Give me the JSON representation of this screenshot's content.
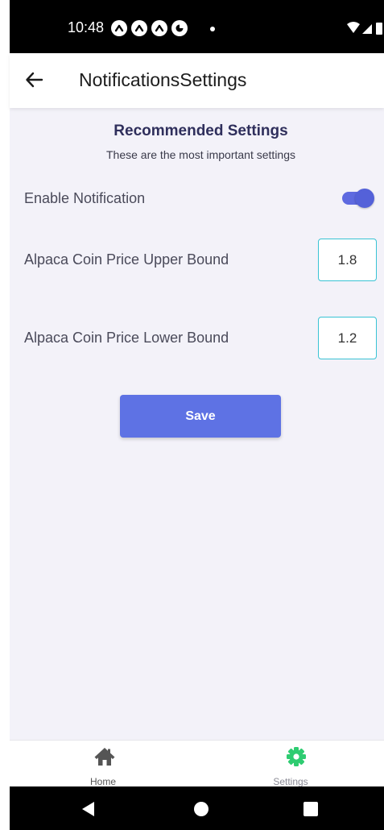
{
  "status_bar": {
    "time": "10:48"
  },
  "app_bar": {
    "title": "NotificationsSettings"
  },
  "section": {
    "title": "Recommended Settings",
    "subtitle": "These are the most important settings"
  },
  "settings": {
    "enable_notification": {
      "label": "Enable Notification",
      "enabled": true
    },
    "upper_bound": {
      "label": "Alpaca Coin Price Upper Bound",
      "value": "1.8"
    },
    "lower_bound": {
      "label": "Alpaca Coin Price Lower Bound",
      "value": "1.2"
    }
  },
  "save_label": "Save",
  "tabs": [
    {
      "label": "Home",
      "icon": "home-icon",
      "active": false
    },
    {
      "label": "Settings",
      "icon": "gear-icon",
      "active": true
    }
  ],
  "colors": {
    "accent": "#5e72e4",
    "toggle": "#5461d9",
    "input_border": "#39c3d4",
    "tab_active": "#2ecc71",
    "tab_active_label": "#8a8a95",
    "tab_inactive": "#555555",
    "content_bg": "#f3f2f9",
    "title_color": "#2f2f5c"
  }
}
